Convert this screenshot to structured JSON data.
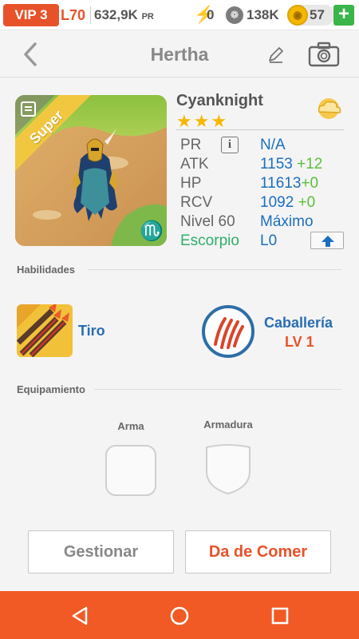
{
  "status": {
    "vip": "VIP 3",
    "level": "L70",
    "power": "632,9K",
    "power_unit": "PR",
    "energy": "0",
    "food": "138K",
    "coins": "57",
    "plus": "+"
  },
  "header": {
    "title": "Hertha"
  },
  "monster": {
    "badge": "Super",
    "name": "Cyanknight",
    "stars": "★★★",
    "stats": [
      {
        "label": "PR",
        "value": "N/A",
        "bonus": ""
      },
      {
        "label": "ATK",
        "value": "1153",
        "bonus": "+12"
      },
      {
        "label": "HP",
        "value": "11613",
        "bonus": "+0"
      },
      {
        "label": "RCV",
        "value": "1092",
        "bonus": "+0"
      },
      {
        "label": "Nivel 60",
        "value": "Máximo",
        "bonus": ""
      },
      {
        "label": "Escorpio",
        "value": "L0",
        "bonus": ""
      }
    ]
  },
  "skills": {
    "title": "Habilidades",
    "items": [
      {
        "name": "Tiro",
        "level": ""
      },
      {
        "name": "Caballería",
        "level": "LV 1"
      }
    ]
  },
  "equipment": {
    "title": "Equipamiento",
    "slots": [
      {
        "label": "Arma"
      },
      {
        "label": "Armadura"
      }
    ]
  },
  "actions": {
    "manage": "Gestionar",
    "feed": "Da de Comer"
  },
  "colors": {
    "accent": "#e8522a",
    "nav": "#f15a24",
    "link": "#2a6db3",
    "green": "#39b54a"
  }
}
